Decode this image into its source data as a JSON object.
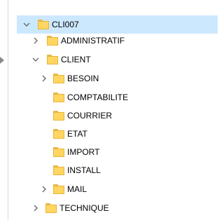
{
  "tree": {
    "items": [
      {
        "label": "CLI007",
        "state": "expanded",
        "selected": true
      },
      {
        "label": "ADMINISTRATIF",
        "state": "collapsed",
        "selected": false
      },
      {
        "label": "CLIENT",
        "state": "expanded",
        "selected": false
      },
      {
        "label": "BESOIN",
        "state": "collapsed",
        "selected": false
      },
      {
        "label": "COMPTABILITE",
        "state": "leaf",
        "selected": false
      },
      {
        "label": "COURRIER",
        "state": "leaf",
        "selected": false
      },
      {
        "label": "ETAT",
        "state": "leaf",
        "selected": false
      },
      {
        "label": "IMPORT",
        "state": "leaf",
        "selected": false
      },
      {
        "label": "INSTALL",
        "state": "leaf",
        "selected": false
      },
      {
        "label": "MAIL",
        "state": "collapsed",
        "selected": false
      },
      {
        "label": "TECHNIQUE",
        "state": "collapsed",
        "selected": false
      }
    ]
  },
  "icons": {
    "folder": "folder-icon",
    "expanded": "chevron-down-icon",
    "collapsed": "chevron-right-icon"
  },
  "colors": {
    "selection": "#cce8ff",
    "folder": "#ffd662",
    "chevron": "#6b6b6b"
  }
}
